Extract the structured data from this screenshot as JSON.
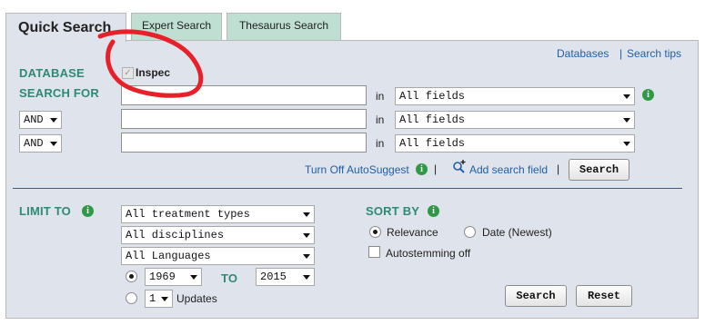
{
  "tabs": {
    "quick": "Quick Search",
    "expert": "Expert Search",
    "thesaurus": "Thesaurus Search"
  },
  "top_links": {
    "databases": "Databases",
    "separator": "|",
    "search_tips": "Search tips"
  },
  "database": {
    "label": "DATABASE",
    "checkbox_label": "Inspec",
    "checked": true
  },
  "search_for": {
    "label": "SEARCH FOR",
    "in_label": "in",
    "rows": [
      {
        "operator": "",
        "value": "",
        "field": "All fields"
      },
      {
        "operator": "AND",
        "value": "",
        "field": "All fields"
      },
      {
        "operator": "AND",
        "value": "",
        "field": "All fields"
      }
    ]
  },
  "actions": {
    "autosuggest": "Turn Off AutoSuggest",
    "separator": "|",
    "add_field": "Add search field",
    "search": "Search"
  },
  "limit_to": {
    "label": "LIMIT TO",
    "treatment": "All treatment types",
    "disciplines": "All disciplines",
    "languages": "All Languages",
    "year_from": "1969",
    "to_label": "TO",
    "year_to": "2015",
    "updates_count": "1",
    "updates_label": "Updates"
  },
  "sort_by": {
    "label": "SORT BY",
    "relevance": "Relevance",
    "date": "Date (Newest)",
    "selected": "relevance",
    "autostemming": "Autostemming off"
  },
  "buttons": {
    "search": "Search",
    "reset": "Reset"
  },
  "colors": {
    "panel_bg": "#dfe3ec",
    "label_green": "#2e8a73",
    "link_blue": "#1f5fa6",
    "annotation_red": "#e8202a",
    "inactive_tab": "#bfdfd3"
  }
}
